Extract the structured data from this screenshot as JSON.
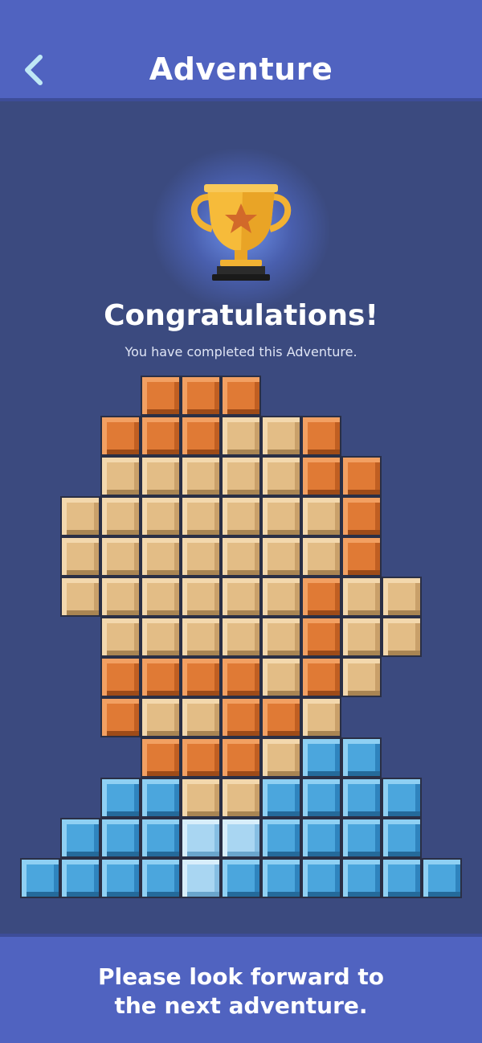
{
  "header": {
    "title": "Adventure",
    "back_icon": "chevron-left-icon"
  },
  "trophy": {
    "icon": "trophy-icon",
    "congrats": "Congratulations!",
    "subtitle": "You have completed this Adventure."
  },
  "footer": {
    "message": "Please look forward to\nthe next adventure."
  },
  "colors": {
    "accent_bar": "#5063c0",
    "background": "#3b4a7f",
    "orange": "#e07a35",
    "tan": "#e3bd86",
    "blue": "#4ba6dd",
    "light_blue": "#a9d6f2"
  },
  "puzzle": {
    "legend": {
      "O": "orange",
      "T": "tan",
      "B": "blue",
      "L": "light_blue"
    },
    "rows": [
      "...OOO....",
      "..OOOTTO...",
      "..TTTTTOO..",
      ".TTTTTTTO..",
      ".TTTTTTTO..",
      ".TTTTTTOTT.",
      "..TTTTTOTT.",
      "..OOOOTOT..",
      "..OTTOOT...",
      "...OOOTBB..",
      "..BBTTBBBB.",
      ".BBBLLBBBB.",
      "BBBBLBBBBBB"
    ]
  }
}
